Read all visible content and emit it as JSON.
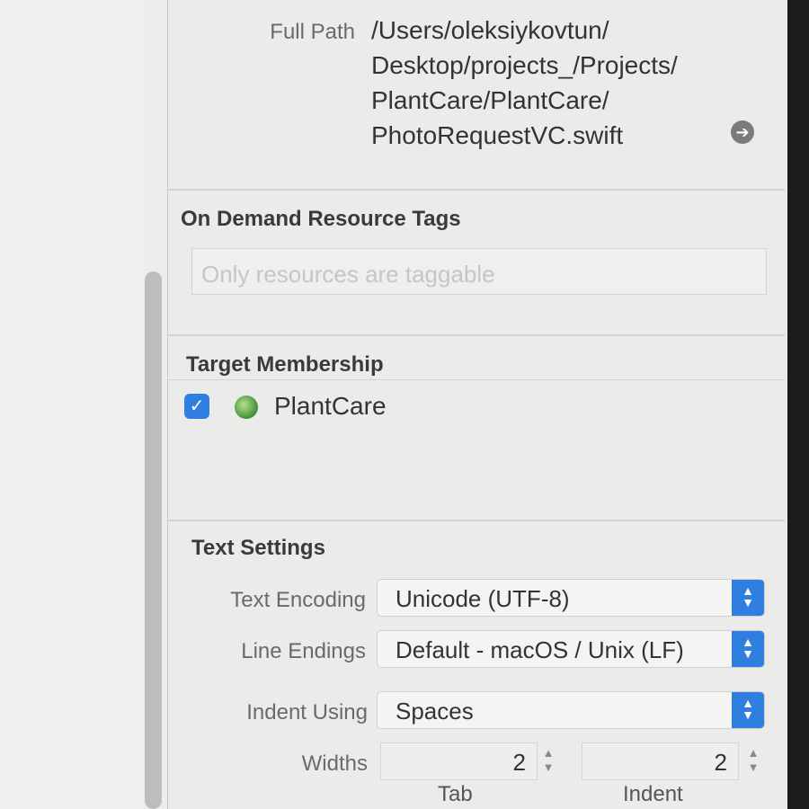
{
  "identity": {
    "full_path_label": "Full Path",
    "full_path_lines": [
      "/Users/oleksiykovtun/",
      "Desktop/projects_/Projects/",
      "PlantCare/PlantCare/",
      "PhotoRequestVC.swift"
    ]
  },
  "on_demand": {
    "title": "On Demand Resource Tags",
    "placeholder": "Only resources are taggable"
  },
  "target_membership": {
    "title": "Target Membership",
    "targets": [
      {
        "name": "PlantCare",
        "checked": true
      }
    ]
  },
  "text_settings": {
    "title": "Text Settings",
    "encoding_label": "Text Encoding",
    "encoding_value": "Unicode (UTF-8)",
    "line_endings_label": "Line Endings",
    "line_endings_value": "Default - macOS / Unix (LF)",
    "indent_using_label": "Indent Using",
    "indent_using_value": "Spaces",
    "widths_label": "Widths",
    "tab_width": "2",
    "indent_width": "2",
    "tab_label": "Tab",
    "indent_label": "Indent"
  },
  "colors": {
    "accent": "#2f7fe0",
    "panel_bg": "#ebebe9"
  }
}
